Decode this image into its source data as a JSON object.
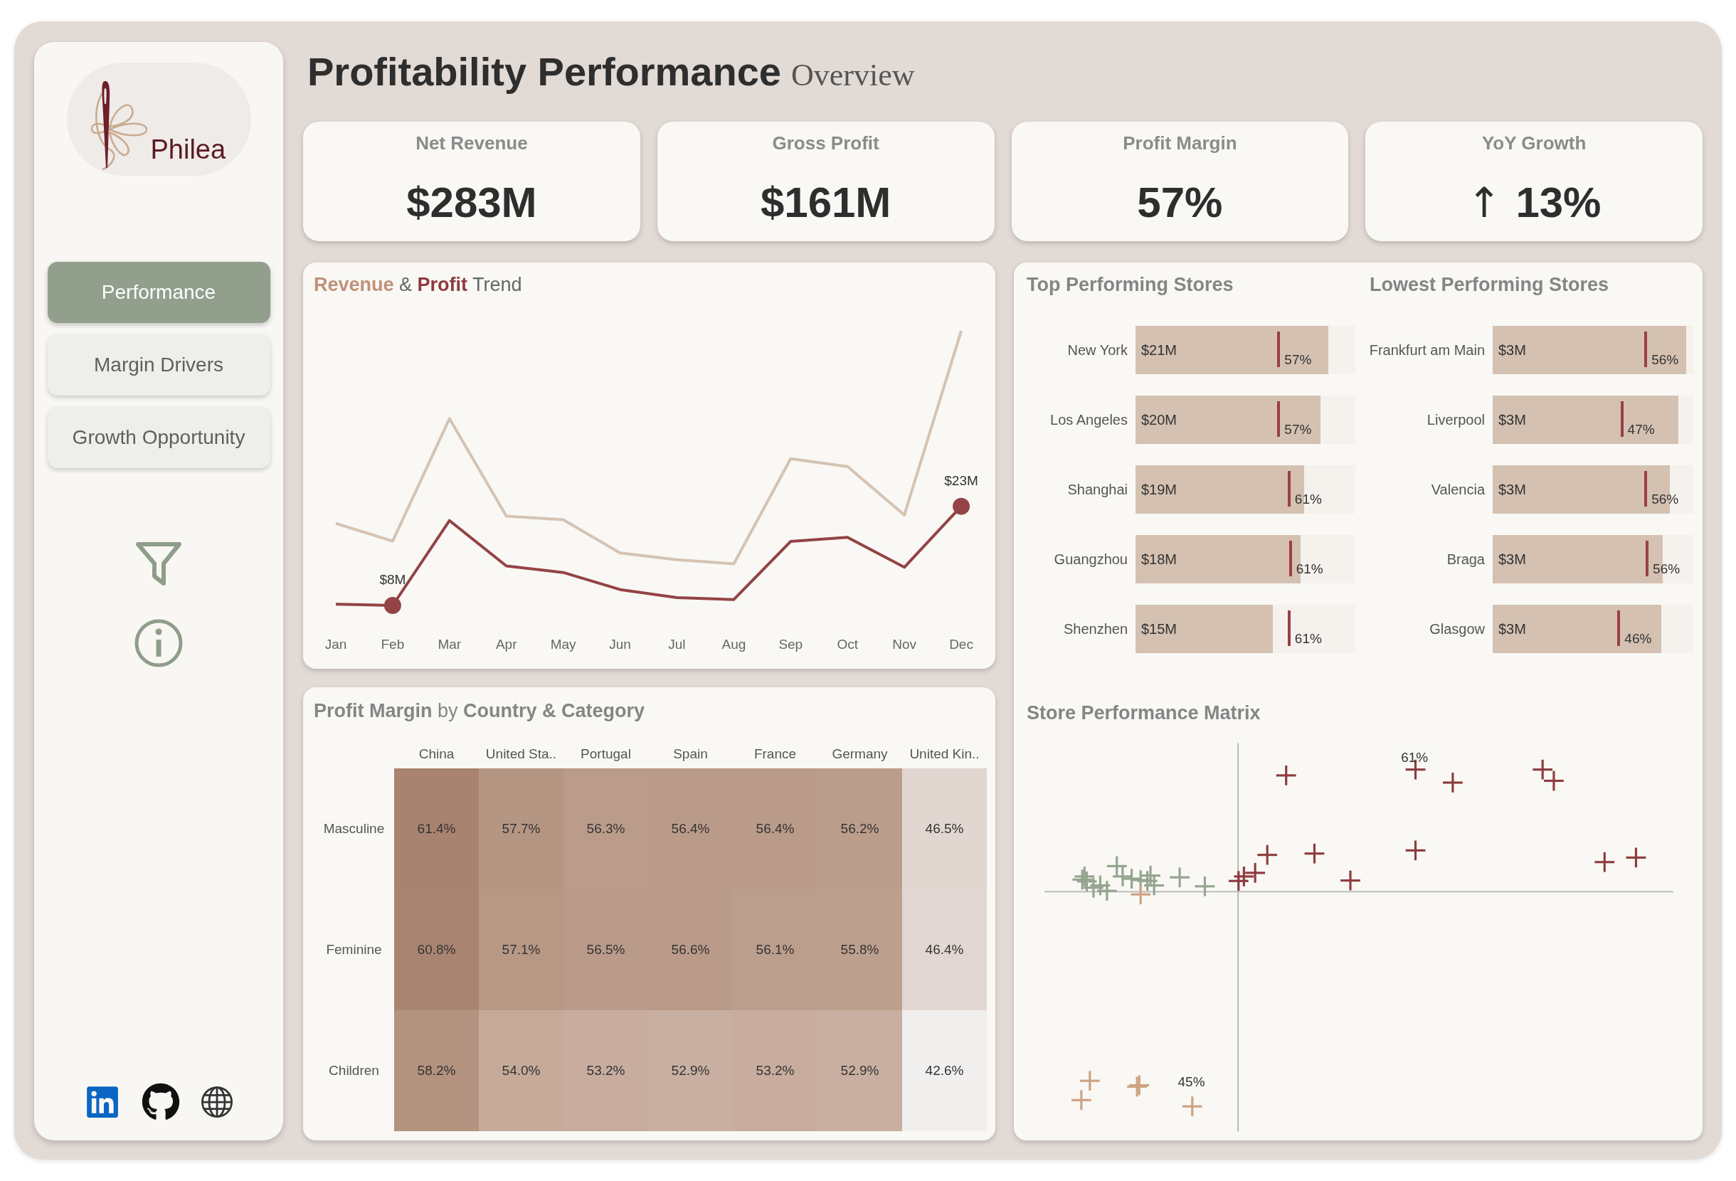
{
  "sidebar": {
    "logo": {
      "text": "Philea"
    },
    "nav": [
      {
        "label": "Performance",
        "selected": true
      },
      {
        "label": "Margin Drivers",
        "selected": false
      },
      {
        "label": "Growth Opportunity",
        "selected": false
      }
    ]
  },
  "header": {
    "title": "Profitability Performance",
    "subtitle": "Overview"
  },
  "kpis": [
    {
      "label": "Net Revenue",
      "value": "$283M"
    },
    {
      "label": "Gross Profit",
      "value": "$161M"
    },
    {
      "label": "Profit Margin",
      "value": "57%"
    },
    {
      "label": "YoY Growth",
      "value": "13%",
      "arrow": "↑"
    }
  ],
  "trend": {
    "title": "**Revenue** & **Profit** Trend",
    "months": [
      "Jan",
      "Feb",
      "Mar",
      "Apr",
      "May",
      "Jun",
      "Jul",
      "Aug",
      "Sep",
      "Oct",
      "Nov",
      "Dec"
    ],
    "point_labels": [
      "$8M",
      "$23M"
    ]
  },
  "store_panels": [
    {
      "title": "Top Performing Stores",
      "rows": [
        {
          "name": "New York",
          "revenue": {
            "label": "$21M",
            "level": 0.877
          },
          "margin": {
            "label": "57%",
            "level": 0.658
          }
        },
        {
          "name": "Los Angeles",
          "revenue": {
            "label": "$20M",
            "level": 0.84
          },
          "margin": {
            "label": "57%",
            "level": 0.658
          }
        },
        {
          "name": "Shanghai",
          "revenue": {
            "label": "$19M",
            "level": 0.768
          },
          "margin": {
            "label": "61%",
            "level": 0.705
          }
        },
        {
          "name": "Guangzhou",
          "revenue": {
            "label": "$18M",
            "level": 0.75
          },
          "margin": {
            "label": "61%",
            "level": 0.711
          }
        },
        {
          "name": "Shenzhen",
          "revenue": {
            "label": "$15M",
            "level": 0.625
          },
          "margin": {
            "label": "61%",
            "level": 0.705
          }
        }
      ]
    },
    {
      "title": "Lowest Performing Stores",
      "rows": [
        {
          "name": "Frankfurt am Main",
          "revenue": {
            "label": "$3M",
            "level": 0.963
          },
          "margin": {
            "label": "56%",
            "level": 0.77
          }
        },
        {
          "name": "Liverpool",
          "revenue": {
            "label": "$3M",
            "level": 0.927
          },
          "margin": {
            "label": "47%",
            "level": 0.651
          }
        },
        {
          "name": "Valencia",
          "revenue": {
            "label": "$3M",
            "level": 0.884
          },
          "margin": {
            "label": "56%",
            "level": 0.77
          }
        },
        {
          "name": "Braga",
          "revenue": {
            "label": "$3M",
            "level": 0.849
          },
          "margin": {
            "label": "56%",
            "level": 0.777
          }
        },
        {
          "name": "Glasgow",
          "revenue": {
            "label": "$3M",
            "level": 0.842
          },
          "margin": {
            "label": "46%",
            "level": 0.636
          }
        }
      ]
    }
  ],
  "heatmap": {
    "title": "**Profit Margin** by **Country & Category**",
    "columns": [
      "China",
      "United Sta..",
      "Portugal",
      "Spain",
      "France",
      "Germany",
      "United Kin.."
    ],
    "rows": [
      {
        "label": "Masculine",
        "cells": [
          {
            "value": "61.4%",
            "color": "#a8836f"
          },
          {
            "value": "57.7%",
            "color": "#b59683"
          },
          {
            "value": "56.3%",
            "color": "#bb9c8a"
          },
          {
            "value": "56.4%",
            "color": "#ba9b89"
          },
          {
            "value": "56.4%",
            "color": "#ba9b89"
          },
          {
            "value": "56.2%",
            "color": "#bb9d8b"
          },
          {
            "value": "46.5%",
            "color": "#e2d6d1"
          }
        ]
      },
      {
        "label": "Feminine",
        "cells": [
          {
            "value": "60.8%",
            "color": "#a98571"
          },
          {
            "value": "57.1%",
            "color": "#b79885"
          },
          {
            "value": "56.5%",
            "color": "#ba9b89"
          },
          {
            "value": "56.6%",
            "color": "#ba9a88"
          },
          {
            "value": "56.1%",
            "color": "#bc9e8c"
          },
          {
            "value": "55.8%",
            "color": "#bd9f8e"
          },
          {
            "value": "46.4%",
            "color": "#e2d7d2"
          }
        ]
      },
      {
        "label": "Children",
        "cells": [
          {
            "value": "58.2%",
            "color": "#b3927f"
          },
          {
            "value": "54.0%",
            "color": "#c5aa9a"
          },
          {
            "value": "53.2%",
            "color": "#c8ad9f"
          },
          {
            "value": "52.9%",
            "color": "#c9afa1"
          },
          {
            "value": "53.2%",
            "color": "#c8ad9f"
          },
          {
            "value": "52.9%",
            "color": "#c9afa1"
          },
          {
            "value": "42.6%",
            "color": "#f1efee"
          }
        ]
      }
    ]
  },
  "matrix": {
    "title": "Store Performance Matrix",
    "labels": [
      "61%",
      "45%"
    ]
  }
}
